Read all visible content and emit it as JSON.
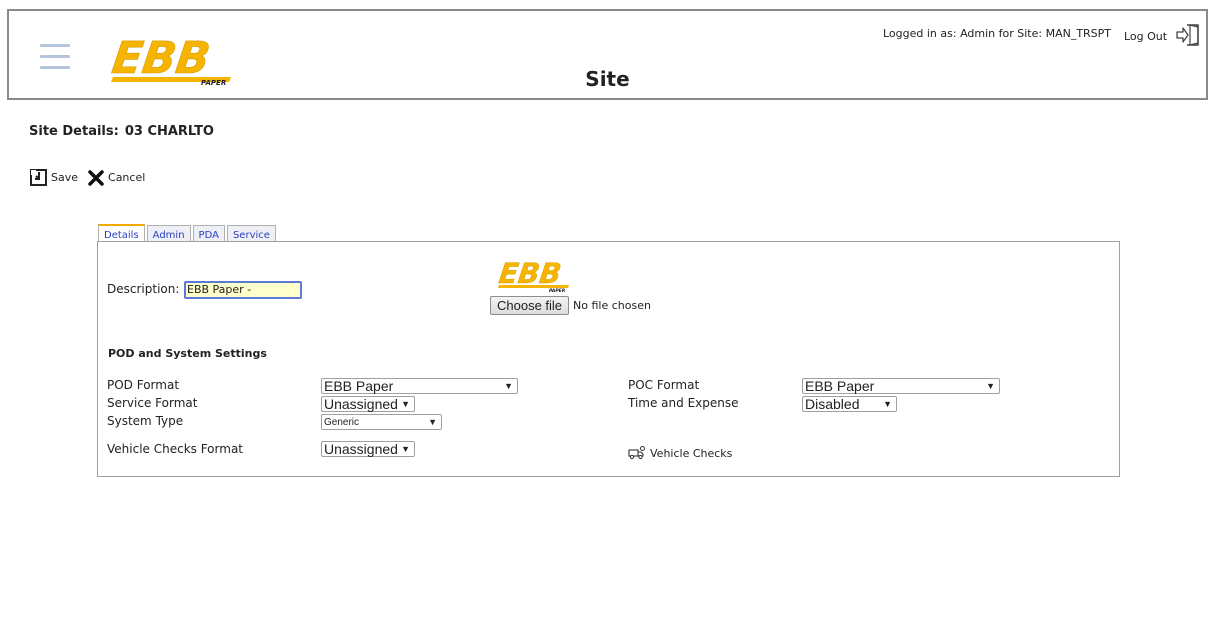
{
  "header": {
    "title": "Site",
    "logo_text": "EBB",
    "logo_subtext": "PAPER",
    "login_info": "Logged in as: Admin for Site: MAN_TRSPT",
    "logout_label": "Log Out",
    "menu_icon": "hamburger-menu-icon",
    "logout_icon": "exit-door-icon"
  },
  "site": {
    "label": "Site Details:",
    "code": "03 CHARLTO"
  },
  "toolbar": {
    "save_label": "Save",
    "cancel_label": "Cancel"
  },
  "tabs": [
    {
      "label": "Details",
      "active": true
    },
    {
      "label": "Admin",
      "active": false
    },
    {
      "label": "PDA",
      "active": false
    },
    {
      "label": "Service",
      "active": false
    }
  ],
  "details": {
    "description_label": "Description:",
    "description_value": "EBB Paper - Farnborough",
    "choose_file_label": "Choose file",
    "no_file_text": "No file chosen",
    "section_title": "POD and System Settings",
    "fields": {
      "pod_format": {
        "label": "POD Format",
        "value": "EBB Paper"
      },
      "service_format": {
        "label": "Service Format",
        "value": "Unassigned"
      },
      "system_type": {
        "label": "System Type",
        "value": "Generic"
      },
      "vehicle_checks_format": {
        "label": "Vehicle Checks Format",
        "value": "Unassigned"
      },
      "poc_format": {
        "label": "POC Format",
        "value": "EBB Paper"
      },
      "time_and_expense": {
        "label": "Time and Expense",
        "value": "Disabled"
      }
    },
    "vehicle_checks_link": "Vehicle Checks"
  },
  "colors": {
    "logo_yellow": "#F5B400",
    "header_border": "#8a8a8a",
    "tab_link": "#2a3fbf",
    "input_highlight": "#ffffcc"
  }
}
